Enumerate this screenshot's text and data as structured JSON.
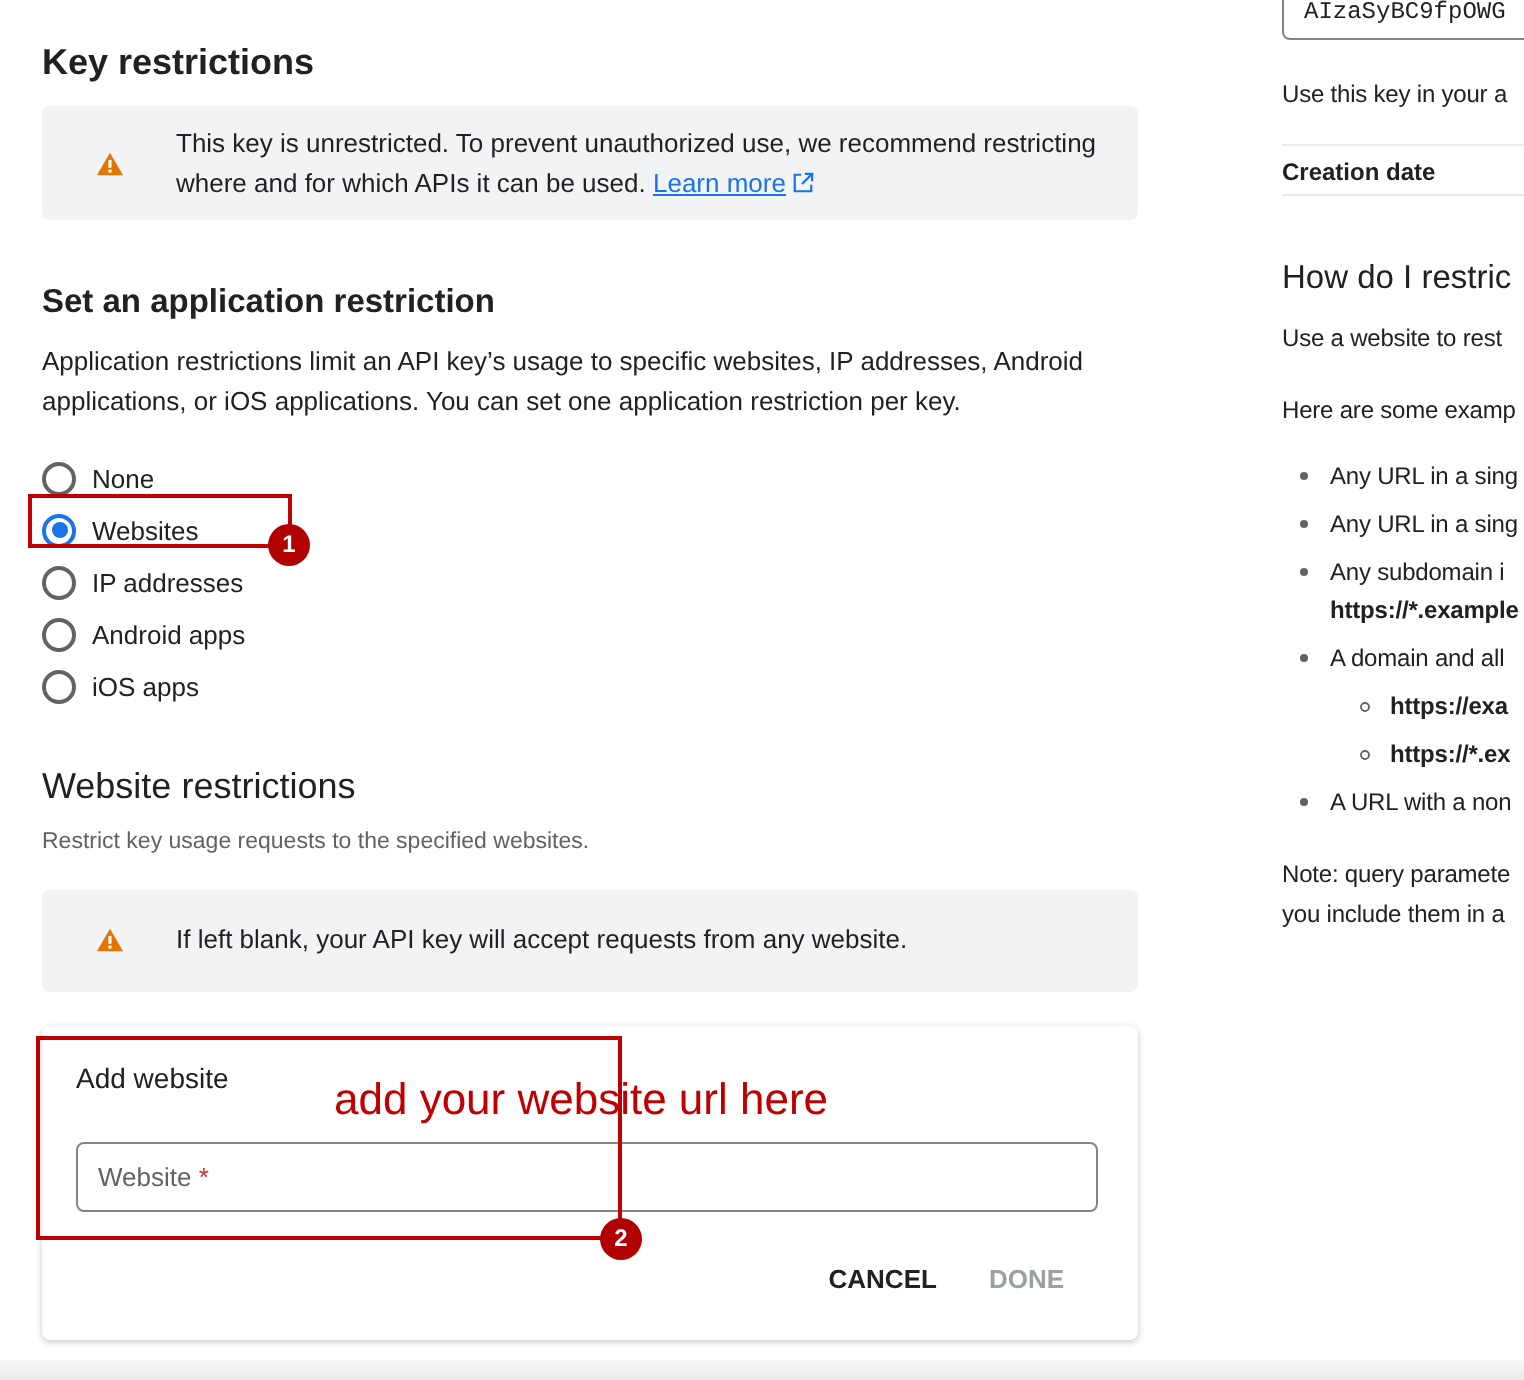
{
  "key_restrictions": {
    "title": "Key restrictions",
    "warning": {
      "text": "This key is unrestricted. To prevent unauthorized use, we recommend restricting where and for which APIs it can be used.",
      "link": "Learn more"
    }
  },
  "application_restriction": {
    "title": "Set an application restriction",
    "description": "Application restrictions limit an API key’s usage to specific websites, IP addresses, Android applications, or iOS applications. You can set one application restriction per key.",
    "options": [
      {
        "label": "None",
        "selected": false
      },
      {
        "label": "Websites",
        "selected": true
      },
      {
        "label": "IP addresses",
        "selected": false
      },
      {
        "label": "Android apps",
        "selected": false
      },
      {
        "label": "iOS apps",
        "selected": false
      }
    ]
  },
  "website_restrictions": {
    "title": "Website restrictions",
    "description": "Restrict key usage requests to the specified websites.",
    "warning": {
      "text": "If left blank, your API key will accept requests from any website."
    },
    "add_website": {
      "title": "Add website",
      "field": {
        "placeholder": "Website",
        "required_mark": "*"
      },
      "buttons": [
        {
          "label": "CANCEL",
          "disabled": false
        },
        {
          "label": "DONE",
          "disabled": true
        }
      ]
    }
  },
  "side_panel": {
    "api_key": "AIzaSyBC9fpOWG",
    "key_hint": "Use this key in your a",
    "creation_date_label": "Creation date",
    "help": {
      "title": "How do I restric",
      "paragraphs": [
        "Use a website to rest",
        "Here are some examp"
      ],
      "examples": [
        {
          "text": "Any URL in a sing"
        },
        {
          "text": "Any URL in a sing"
        },
        {
          "text": "Any subdomain i",
          "example": "https://*.example"
        },
        {
          "text": "A domain and all",
          "children": [
            {
              "example": "https://exa"
            },
            {
              "example": "https://*.ex"
            }
          ]
        },
        {
          "text": "A URL with a non"
        }
      ],
      "note": [
        "Note: query paramete",
        "you include them in a"
      ]
    }
  },
  "annotations": [
    {
      "kind": "frame",
      "badge": "1"
    },
    {
      "kind": "frame",
      "badge": "2"
    },
    {
      "kind": "caption",
      "text": "add your website url here"
    }
  ]
}
